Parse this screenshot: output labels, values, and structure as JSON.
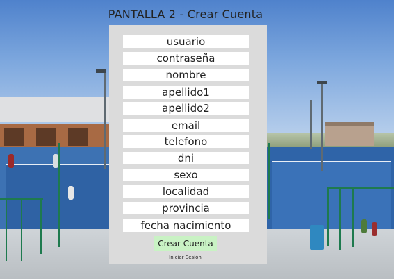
{
  "title": "PANTALLA 2 - Crear Cuenta",
  "form": {
    "fields": [
      {
        "placeholder": "usuario"
      },
      {
        "placeholder": "contraseña"
      },
      {
        "placeholder": "nombre"
      },
      {
        "placeholder": "apellido1"
      },
      {
        "placeholder": "apellido2"
      },
      {
        "placeholder": "email"
      },
      {
        "placeholder": "telefono"
      },
      {
        "placeholder": "dni"
      },
      {
        "placeholder": "sexo"
      },
      {
        "placeholder": "localidad"
      },
      {
        "placeholder": "provincia"
      },
      {
        "placeholder": "fecha nacimiento"
      }
    ],
    "submit_label": "Crear Cuenta",
    "login_link": "Iniciar Sesión"
  },
  "colors": {
    "panel": "#dbdbdb",
    "field": "#ffffff",
    "submit_button": "#c9f2c4"
  }
}
